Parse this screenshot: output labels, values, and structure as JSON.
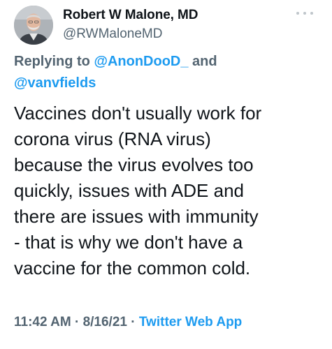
{
  "author": {
    "name": "Robert W Malone, MD",
    "handle": "@RWMaloneMD"
  },
  "more_icon": "more-horizontal-icon",
  "reply": {
    "prefix": "Replying to ",
    "mention_1": "@AnonDooD_",
    "joiner": " and",
    "mention_2": "@vanvfields"
  },
  "body_lines": [
    "Vaccines don't usually work for",
    "corona virus (RNA virus)",
    "because the virus evolves too",
    "quickly, issues with ADE and",
    "there are issues with immunity",
    "- that is why we don't have a",
    "vaccine for the common cold."
  ],
  "meta": {
    "time": "11:42 AM",
    "sep1": " · ",
    "date": "8/16/21",
    "sep2": " · ",
    "source": "Twitter Web App"
  },
  "colors": {
    "text": "#0f1419",
    "secondary": "#536471",
    "link": "#1d9bf0"
  }
}
